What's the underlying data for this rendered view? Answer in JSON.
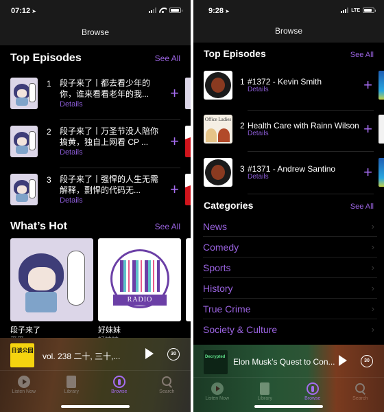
{
  "left": {
    "status": {
      "time": "07:12"
    },
    "nav_title": "Browse",
    "top_episodes": {
      "title": "Top Episodes",
      "see_all": "See All",
      "items": [
        {
          "rank": "1",
          "title": "段子来了丨都去看少年的你，谁来看看老年的我...",
          "details": "Details"
        },
        {
          "rank": "2",
          "title": "段子来了丨万圣节没人陪你搞黄，独自上网看 CP ...",
          "details": "Details"
        },
        {
          "rank": "3",
          "title": "段子来了丨强悍的人生无需解释，剽悍的代码无...",
          "details": "Details"
        }
      ]
    },
    "whats_hot": {
      "title": "What’s Hot",
      "see_all": "See All",
      "items": [
        {
          "title": "段子来了",
          "subtitle": "平平"
        },
        {
          "title": "好妹妹",
          "subtitle": "好妹妹",
          "art_text": "RADIO"
        }
      ]
    },
    "mini_player": {
      "title": "vol. 238 二十, 三十,...",
      "skip_label": "30",
      "cover_text": "日谈公园"
    },
    "tabs": [
      {
        "label": "Listen Now",
        "icon": "play-circle-icon"
      },
      {
        "label": "Library",
        "icon": "library-icon"
      },
      {
        "label": "Browse",
        "icon": "podcasts-icon",
        "active": true
      },
      {
        "label": "Search",
        "icon": "search-icon"
      }
    ]
  },
  "right": {
    "status": {
      "time": "9:28",
      "network": "LTE"
    },
    "nav_title": "Browse",
    "top_episodes": {
      "title": "Top Episodes",
      "see_all": "See All",
      "items": [
        {
          "rank": "1",
          "title": "#1372 - Kevin Smith",
          "details": "Details"
        },
        {
          "rank": "2",
          "title": "Health Care with Rainn Wilson",
          "details": "Details",
          "art_text": "Office Ladies"
        },
        {
          "rank": "3",
          "title": "#1371 - Andrew Santino",
          "details": "Details"
        }
      ]
    },
    "categories": {
      "title": "Categories",
      "see_all": "See All",
      "items": [
        "News",
        "Comedy",
        "Sports",
        "History",
        "True Crime",
        "Society & Culture"
      ]
    },
    "mini_player": {
      "title": "Elon Musk’s Quest to Con...",
      "skip_label": "30",
      "cover_text": "Decrypted"
    },
    "tabs": [
      {
        "label": "Listen Now",
        "icon": "play-circle-icon"
      },
      {
        "label": "Library",
        "icon": "library-icon"
      },
      {
        "label": "Browse",
        "icon": "podcasts-icon",
        "active": true
      },
      {
        "label": "Search",
        "icon": "search-icon"
      }
    ]
  },
  "colors": {
    "accent": "#9a63e0",
    "background": "#000000",
    "header": "#1a1a1a"
  }
}
